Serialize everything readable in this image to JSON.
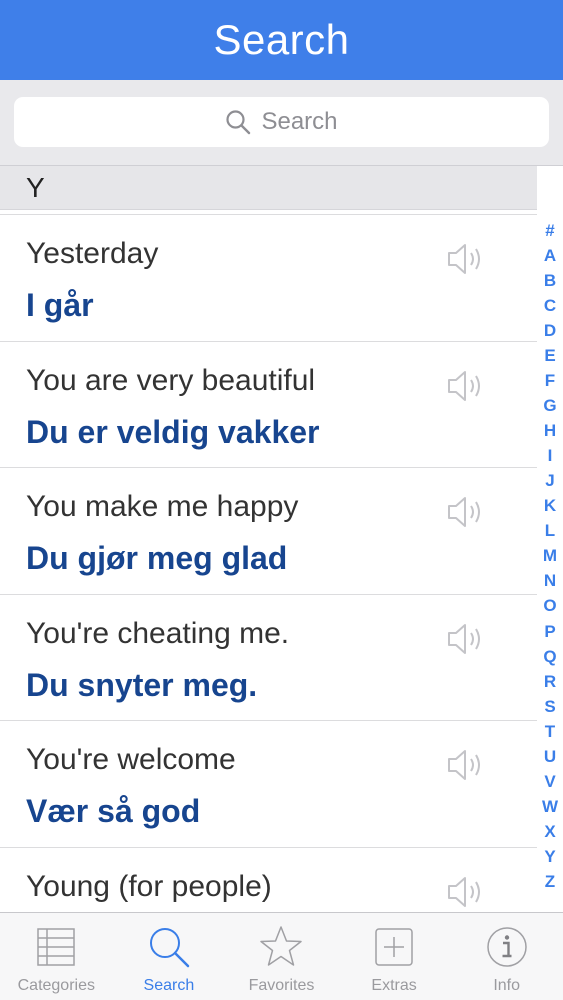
{
  "nav": {
    "title": "Search"
  },
  "search": {
    "placeholder": "Search"
  },
  "section": {
    "letter": "Y"
  },
  "phrases": [
    {
      "english": "Yesterday",
      "norwegian": "I går"
    },
    {
      "english": "You are very beautiful",
      "norwegian": "Du er veldig vakker"
    },
    {
      "english": "You make me happy",
      "norwegian": "Du gjør meg glad"
    },
    {
      "english": "You're cheating me.",
      "norwegian": "Du snyter meg."
    },
    {
      "english": "You're welcome",
      "norwegian": "Vær så god"
    },
    {
      "english": "Young (for people)",
      "norwegian": ""
    }
  ],
  "index": [
    "#",
    "A",
    "B",
    "C",
    "D",
    "E",
    "F",
    "G",
    "H",
    "I",
    "J",
    "K",
    "L",
    "M",
    "N",
    "O",
    "P",
    "Q",
    "R",
    "S",
    "T",
    "U",
    "V",
    "W",
    "X",
    "Y",
    "Z"
  ],
  "tabs": [
    {
      "label": "Categories",
      "icon": "list-icon",
      "active": false
    },
    {
      "label": "Search",
      "icon": "magnifier-icon",
      "active": true
    },
    {
      "label": "Favorites",
      "icon": "star-icon",
      "active": false
    },
    {
      "label": "Extras",
      "icon": "plus-box-icon",
      "active": false
    },
    {
      "label": "Info",
      "icon": "info-icon",
      "active": false
    }
  ],
  "colors": {
    "nav_background": "#3f7fe9",
    "accent": "#3a7ee8",
    "translation_text": "#17458f"
  }
}
